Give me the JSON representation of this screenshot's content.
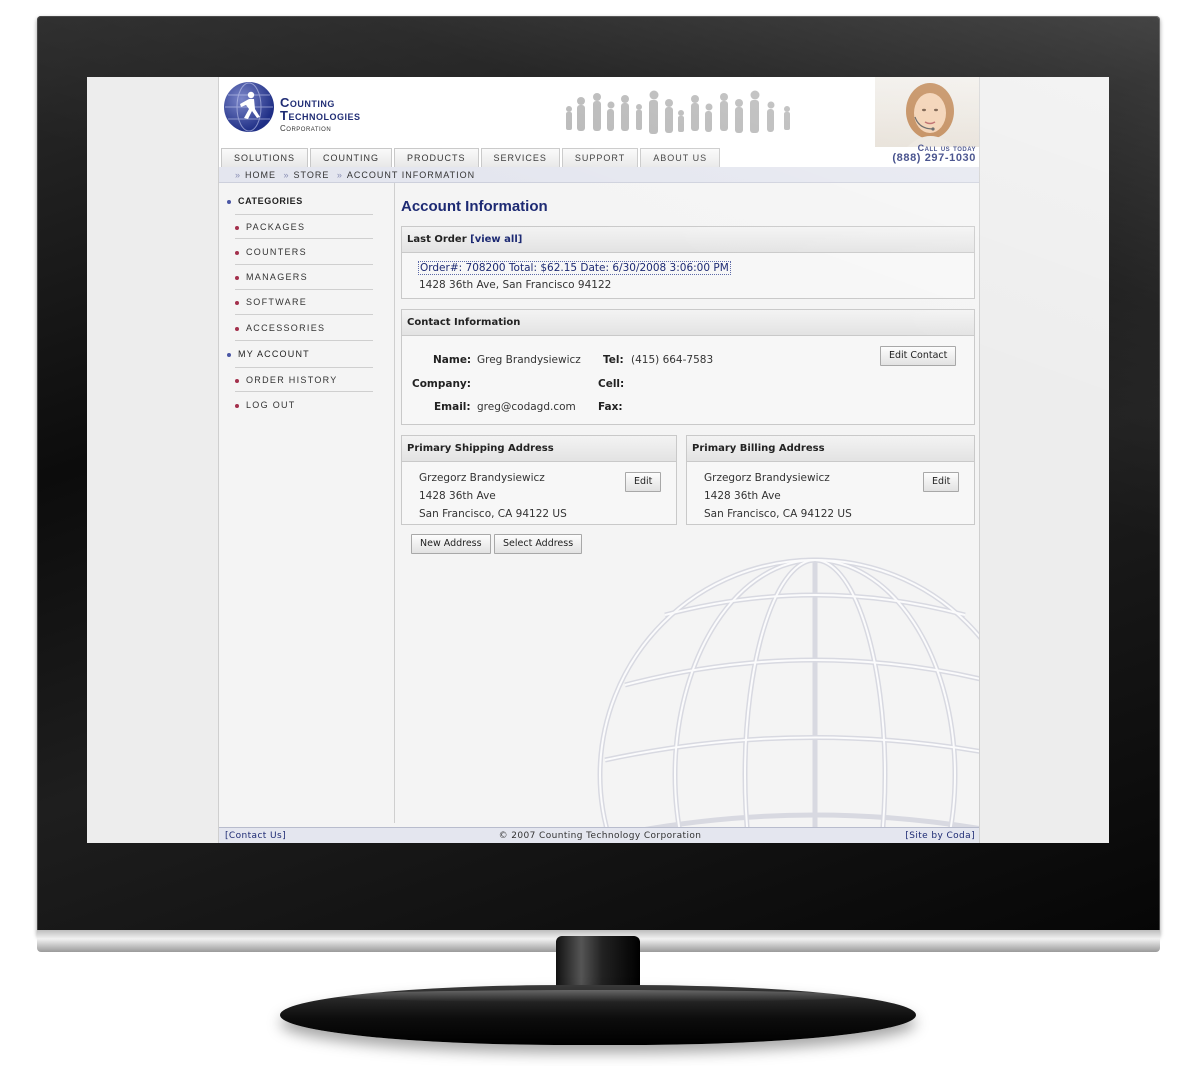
{
  "company": {
    "name_line1": "Counting",
    "name_line2": "Technologies",
    "name_line3": "Corporation"
  },
  "callout": {
    "label": "Call us today",
    "phone": "(888) 297-1030"
  },
  "nav": {
    "tabs": [
      "SOLUTIONS",
      "COUNTING",
      "PRODUCTS",
      "SERVICES",
      "SUPPORT",
      "ABOUT US"
    ]
  },
  "breadcrumb": {
    "items": [
      "HOME",
      "STORE",
      "ACCOUNT INFORMATION"
    ],
    "separator": "»"
  },
  "sidebar": {
    "categories_heading": "CATEGORIES",
    "category_items": [
      "PACKAGES",
      "COUNTERS",
      "MANAGERS",
      "SOFTWARE",
      "ACCESSORIES"
    ],
    "account_heading": "MY ACCOUNT",
    "account_items": [
      "ORDER HISTORY",
      "LOG OUT"
    ]
  },
  "main": {
    "title": "Account Information",
    "last_order": {
      "heading": "Last Order",
      "view_all": "[view all]",
      "order_line": "Order#: 708200 Total: $62.15 Date: 6/30/2008 3:06:00 PM",
      "address_line": "1428 36th Ave, San Francisco  94122"
    },
    "contact": {
      "heading": "Contact Information",
      "name_label": "Name:",
      "name_value": "Greg Brandysiewicz",
      "company_label": "Company:",
      "company_value": "",
      "email_label": "Email:",
      "email_value": "greg@codagd.com",
      "tel_label": "Tel:",
      "tel_value": "(415) 664-7583",
      "cell_label": "Cell:",
      "cell_value": "",
      "fax_label": "Fax:",
      "fax_value": "",
      "edit_button": "Edit Contact"
    },
    "shipping": {
      "heading": "Primary Shipping Address",
      "line1": "Grzegorz Brandysiewicz",
      "line2": "1428 36th Ave",
      "line3": "San Francisco, CA 94122 US",
      "edit_button": "Edit"
    },
    "billing": {
      "heading": "Primary Billing Address",
      "line1": "Grzegorz Brandysiewicz",
      "line2": "1428 36th Ave",
      "line3": "San Francisco, CA 94122  US",
      "edit_button": "Edit"
    },
    "new_address_button": "New Address",
    "select_address_button": "Select Address"
  },
  "footer": {
    "contact_link": "[Contact Us]",
    "copyright": "© 2007 Counting Technology Corporation",
    "credit_link": "[Site by Coda]"
  },
  "colors": {
    "brand_navy": "#1d2a73",
    "bullet_red": "#a3304c",
    "bullet_blue": "#4a56a4",
    "monitor_black": "#0c0c0c"
  }
}
